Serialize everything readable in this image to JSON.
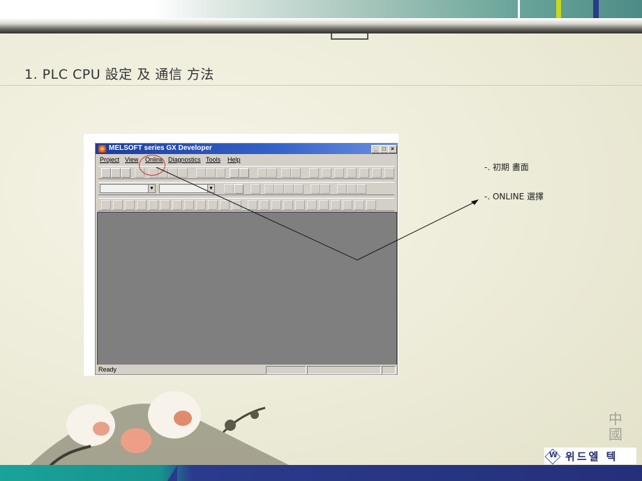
{
  "slide": {
    "title": "1. PLC CPU 設定 及 通信 方法",
    "notes": [
      "-. 初期 畵面",
      "-. ONLINE 選擇"
    ],
    "logo_text": "위드엘 텍",
    "logo_mark": "W"
  },
  "window": {
    "title": "MELSOFT series GX Developer",
    "controls": [
      "_",
      "□",
      "×"
    ],
    "menu": [
      "Project",
      "View",
      "Online",
      "Diagnostics",
      "Tools",
      "Help"
    ],
    "status": "Ready"
  },
  "colors": {
    "title_bar": "#1b3d9b",
    "annotation": "#d0302a",
    "bottom_band": "#24307a",
    "accent_teal": "#1aa39a"
  }
}
